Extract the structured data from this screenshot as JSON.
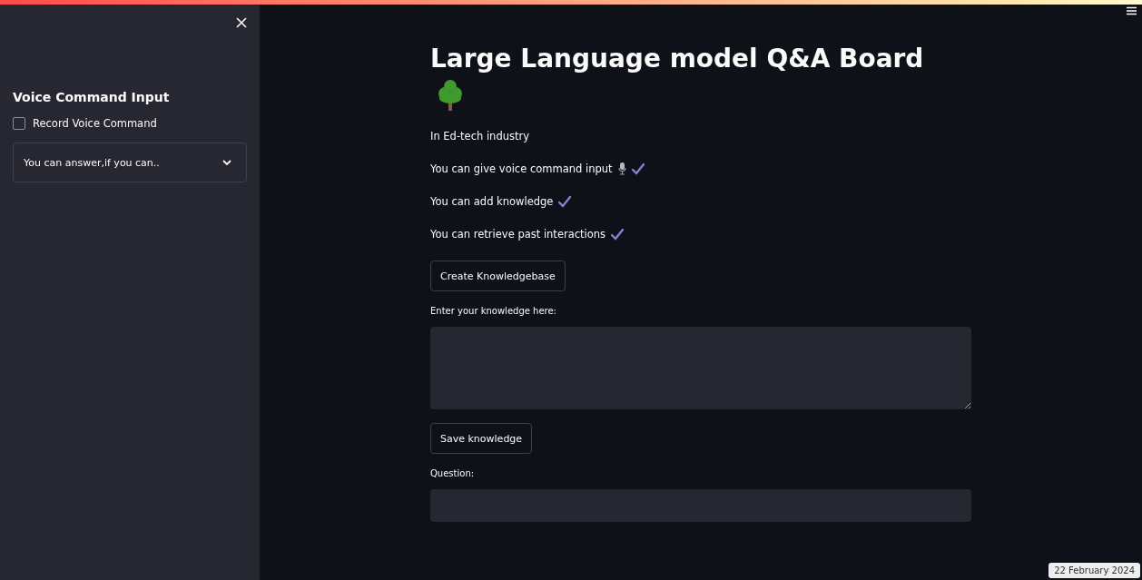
{
  "sidebar": {
    "heading": "Voice Command Input",
    "checkbox": {
      "label": "Record Voice Command",
      "checked": false
    },
    "expander": {
      "label": "You can answer,if you can..",
      "expanded": false
    }
  },
  "main": {
    "title": "Large Language model Q&A Board",
    "subtitle": "In Ed-tech industry",
    "features": [
      {
        "text": "You can give voice command input",
        "kind": "voice"
      },
      {
        "text": "You can add knowledge",
        "kind": "plain"
      },
      {
        "text": "You can retrieve past interactions",
        "kind": "plain"
      }
    ],
    "create_button": "Create Knowledgebase",
    "knowledge_label": "Enter your knowledge here:",
    "save_button": "Save knowledge",
    "question_label": "Question:"
  },
  "date_badge": "22 February 2024"
}
